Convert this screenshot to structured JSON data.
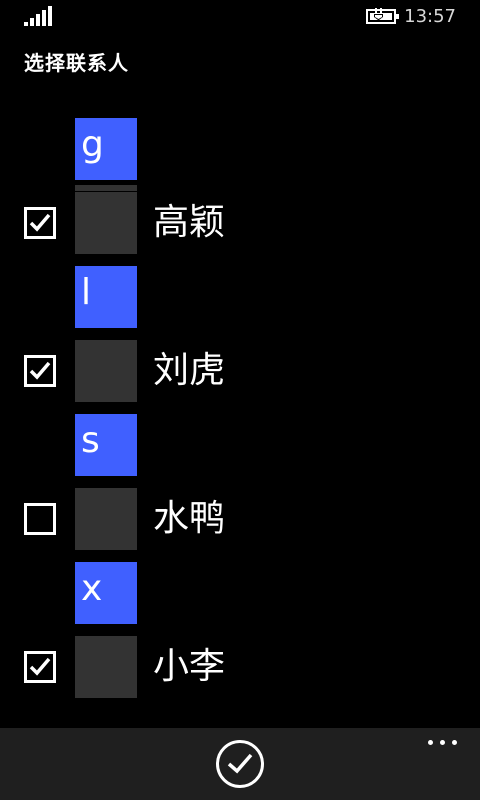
{
  "status_bar": {
    "time": "13:57",
    "signal_icon": "signal-bars-icon",
    "battery_icon": "battery-charging-icon"
  },
  "page": {
    "title": "选择联系人"
  },
  "groups": [
    {
      "letter": "g",
      "contacts": [
        {
          "name": "高颖",
          "checked": true
        }
      ]
    },
    {
      "letter": "l",
      "contacts": [
        {
          "name": "刘虎",
          "checked": true
        }
      ]
    },
    {
      "letter": "s",
      "contacts": [
        {
          "name": "水鸭",
          "checked": false
        }
      ]
    },
    {
      "letter": "x",
      "contacts": [
        {
          "name": "小李",
          "checked": true
        }
      ]
    }
  ],
  "app_bar": {
    "confirm_icon": "check-icon",
    "more_icon": "ellipsis-icon"
  },
  "colors": {
    "accent": "#4060ff",
    "background": "#000000",
    "tile_placeholder": "#333333",
    "app_bar": "#1f1f1f"
  }
}
